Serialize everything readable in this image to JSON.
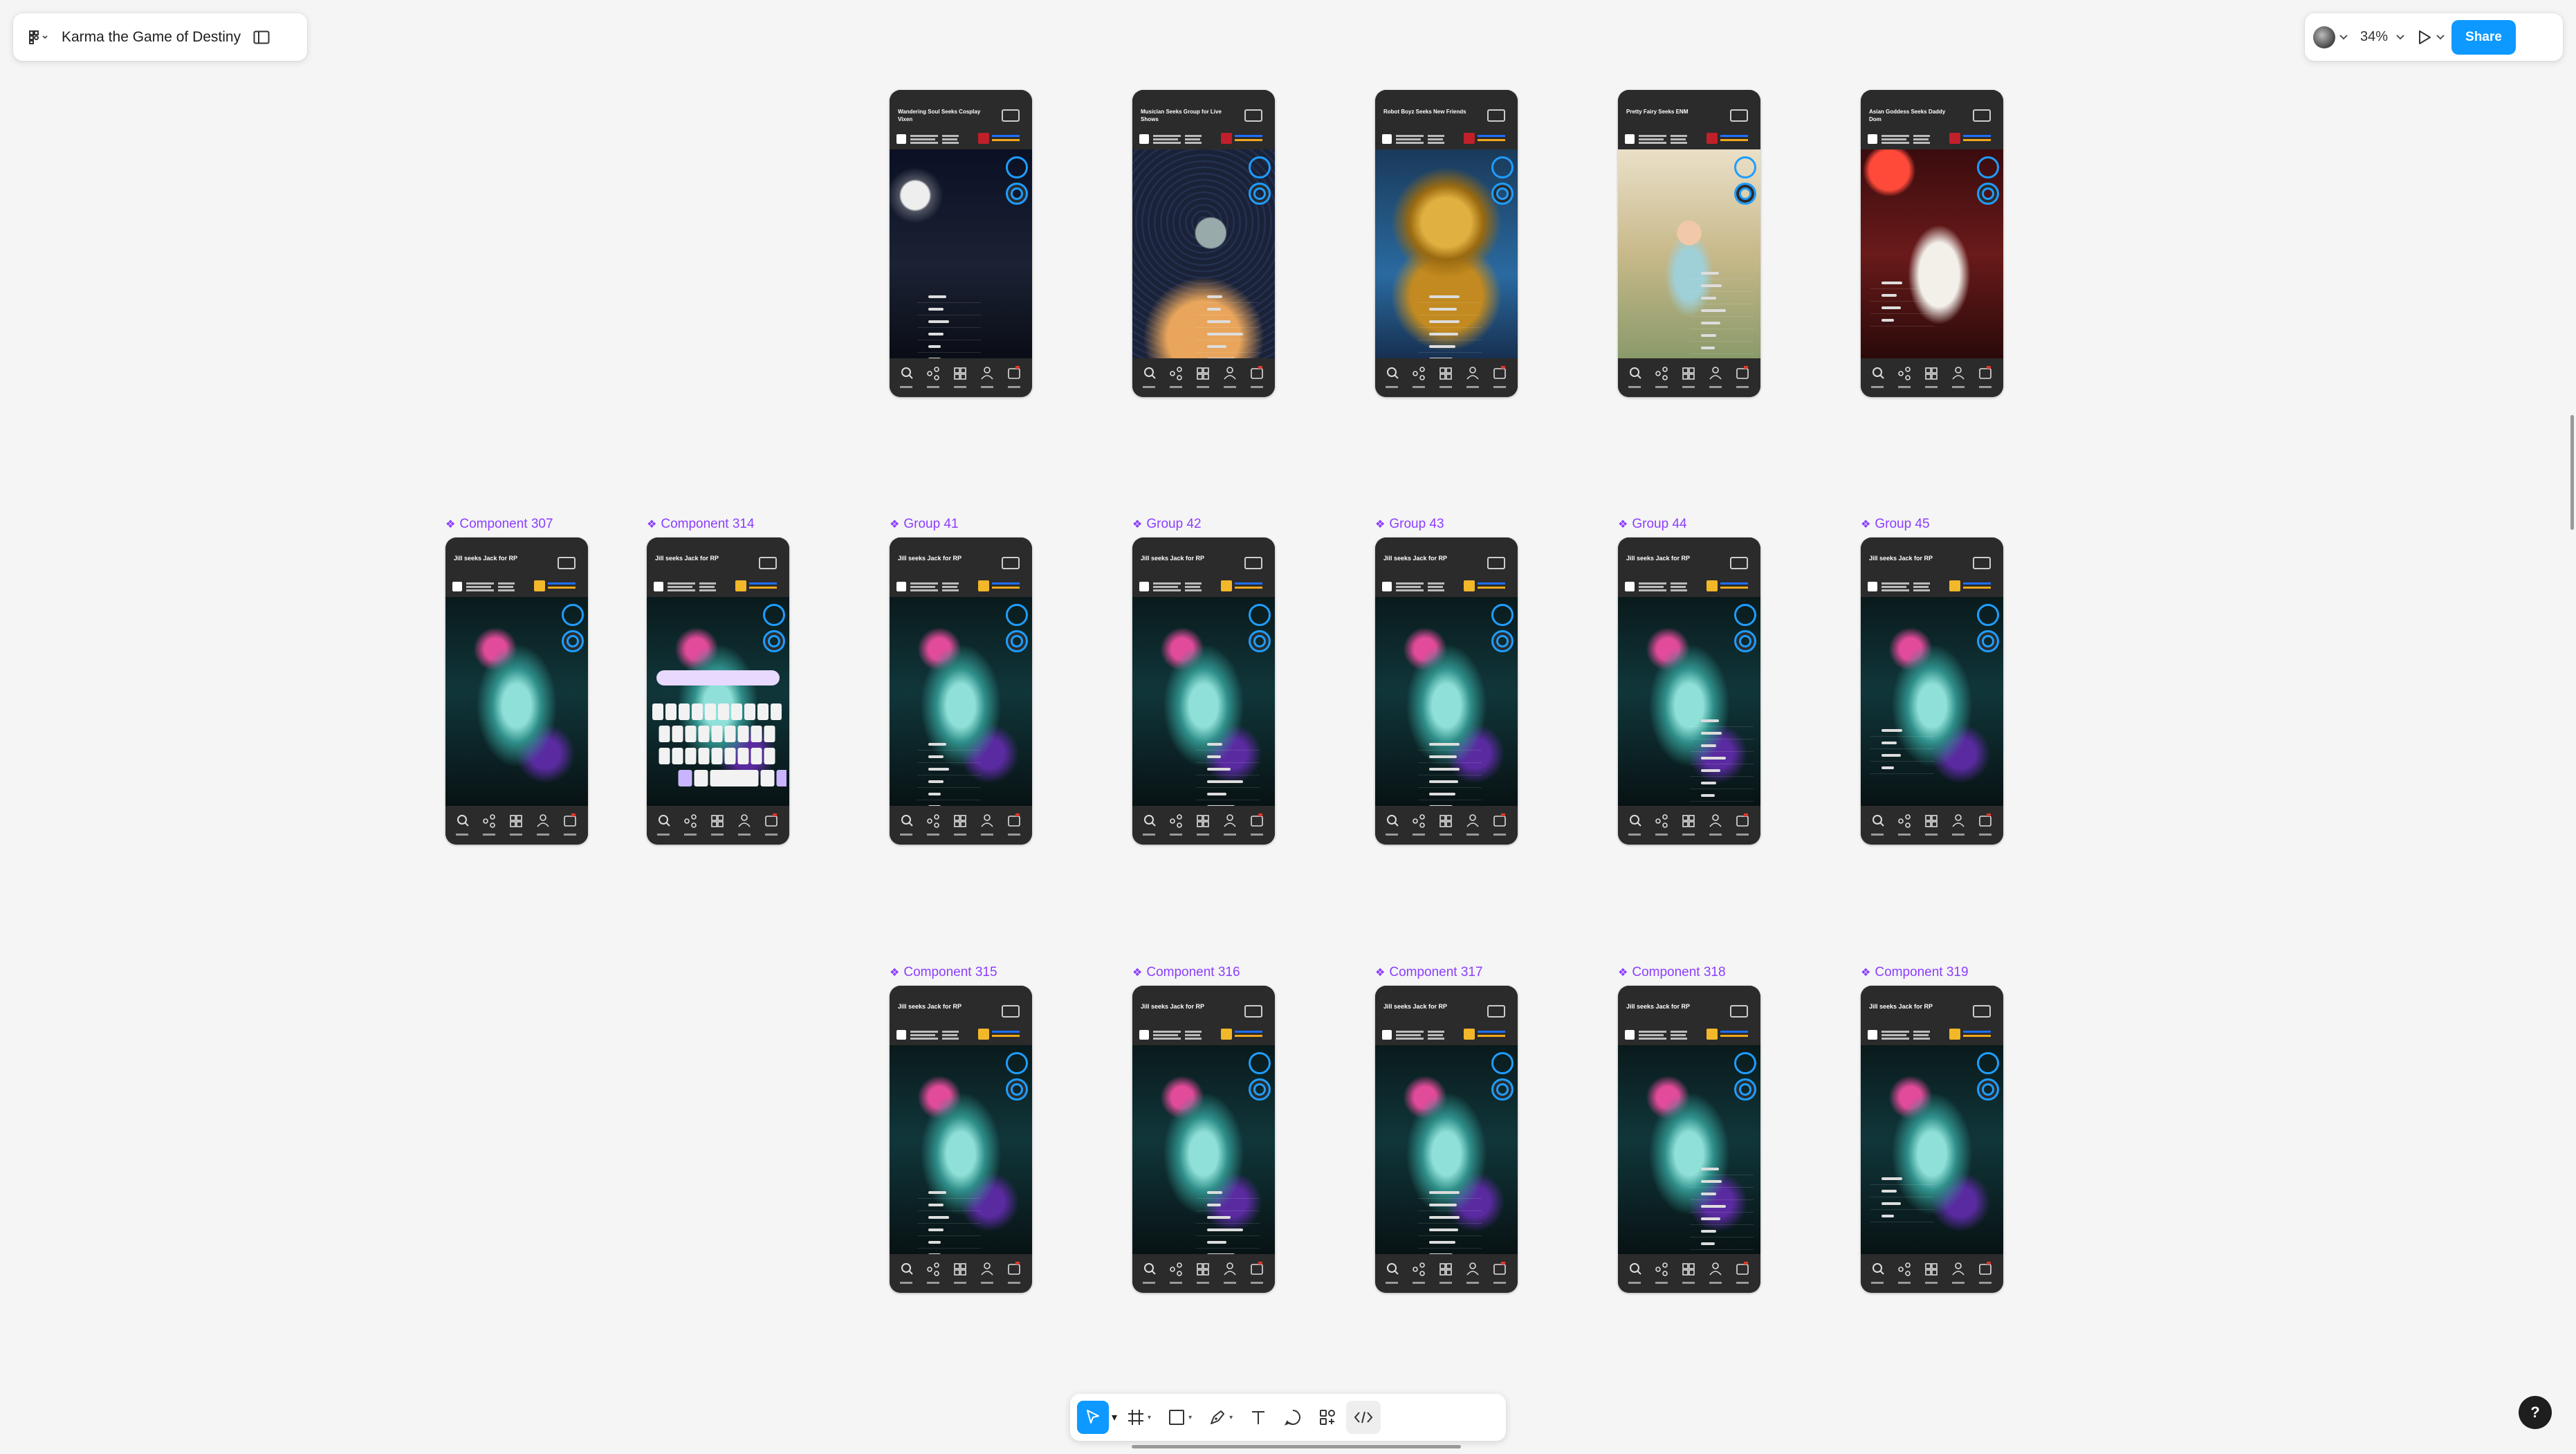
{
  "header": {
    "file_title": "Karma the Game of Destiny",
    "zoom": "34%",
    "share_label": "Share",
    "icons": [
      "figma-menu-icon",
      "sidebar-toggle-icon",
      "avatar",
      "present-play-icon"
    ]
  },
  "rows": [
    {
      "labels": [],
      "frames": [
        {
          "title": "Wandering Soul Seeks Cosplay Vixen",
          "art": "night"
        },
        {
          "title": "Musician Seeks Group for Live Shows",
          "art": "alien"
        },
        {
          "title": "Robot Boyz Seeks New Friends",
          "art": "robot"
        },
        {
          "title": "Pretty Fairy Seeks ENM",
          "art": "fairy"
        },
        {
          "title": "Asian Goddess Seeks Daddy Dom",
          "art": "red"
        }
      ]
    },
    {
      "labels": [
        "Component 307",
        "Component 314",
        "Group 41",
        "Group 42",
        "Group 43",
        "Group 44",
        "Group 45"
      ],
      "frames": [
        {
          "title": "Jill seeks Jack for RP"
        },
        {
          "title": "Jill seeks Jack for RP"
        },
        {
          "title": "Jill seeks Jack for RP"
        },
        {
          "title": "Jill seeks Jack for RP"
        },
        {
          "title": "Jill seeks Jack for RP"
        },
        {
          "title": "Jill seeks Jack for RP"
        },
        {
          "title": "Jill seeks Jack for RP"
        }
      ]
    },
    {
      "labels": [
        "Component 315",
        "Component 316",
        "Component 317",
        "Component 318",
        "Component 319"
      ],
      "frames": [
        {
          "title": "Jill seeks Jack for RP"
        },
        {
          "title": "Jill seeks Jack for RP"
        },
        {
          "title": "Jill seeks Jack for RP"
        },
        {
          "title": "Jill seeks Jack for RP"
        },
        {
          "title": "Jill seeks Jack for RP"
        }
      ]
    }
  ],
  "toolbar": {
    "tools": [
      "move-tool",
      "frame-tool",
      "shape-tool",
      "pen-tool",
      "text-tool",
      "comment-tool",
      "actions-tool",
      "dev-mode-toggle"
    ]
  },
  "help_label": "?"
}
